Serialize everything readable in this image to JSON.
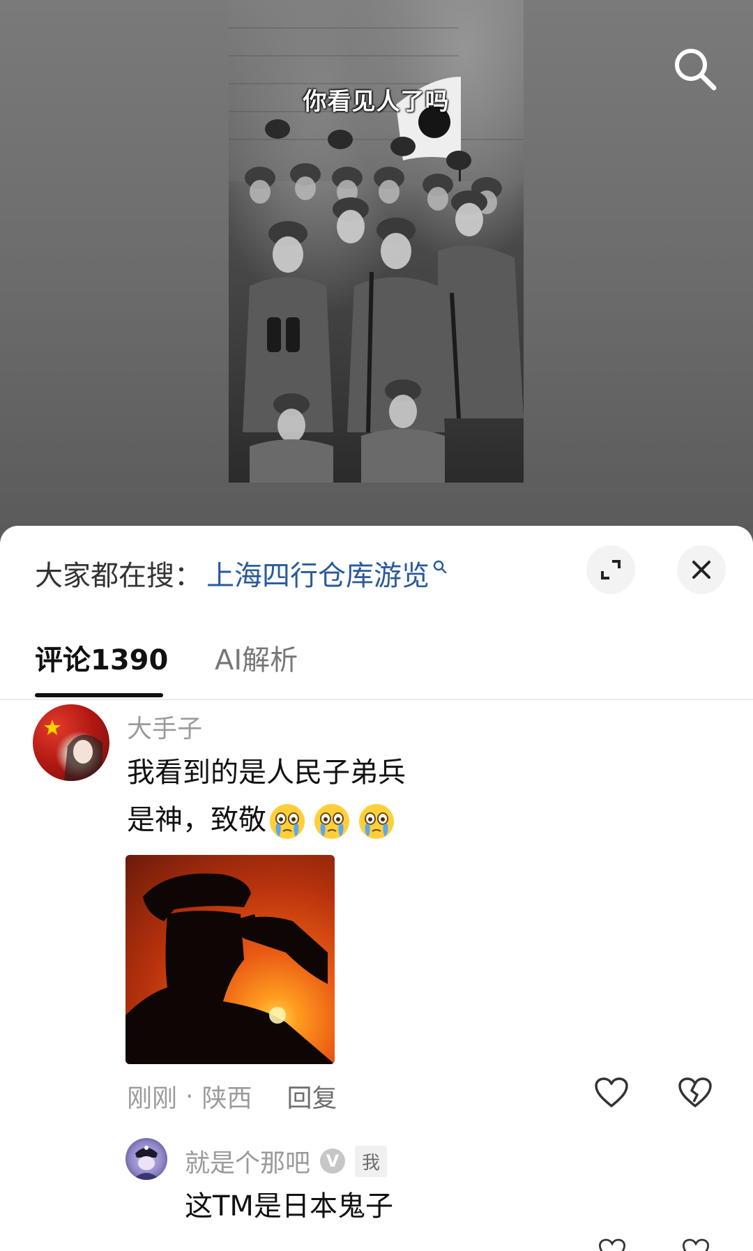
{
  "video": {
    "caption": "你看见人了吗"
  },
  "sheet": {
    "hot_search_prefix": "大家都在搜：",
    "hot_search_term": "上海四行仓库游览",
    "tabs": [
      {
        "label": "评论1390",
        "active": true
      },
      {
        "label": "AI解析",
        "active": false
      }
    ]
  },
  "comments": [
    {
      "username": "大手子",
      "text_line1": "我看到的是人民子弟兵",
      "text_line2": "是神，致敬",
      "emoji": "crying-face",
      "time": "刚刚",
      "location": "陕西",
      "reply_label": "回复",
      "replies": [
        {
          "username": "就是个那吧",
          "badge": "V",
          "tag": "我",
          "text": "这TM是日本鬼子"
        }
      ]
    }
  ],
  "colors": {
    "link_blue": "#2a5a9c",
    "muted_gray": "#9b9b9b"
  }
}
